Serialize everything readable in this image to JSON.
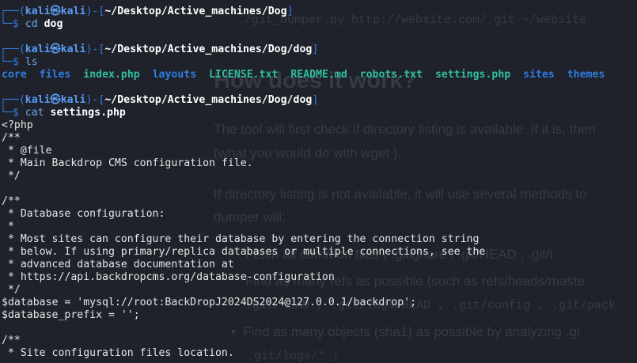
{
  "background_page": {
    "code_line": "./git_dumper.py http://website.com/.git ~/website",
    "heading": "How does it work?",
    "para1_line1": "The tool will first check if directory listing is available. If it is, then",
    "para1_line2": "(what you would do with  wget ).",
    "para2_line1": "If directory listing is not available, it will use several methods to",
    "para2_line2": "dumper will:",
    "bullet1": "Fetch all common files ( .gitignore ,  .git/HEAD ,  .git/i",
    "bullet2": "Find as many refs as possible (such as  refs/heads/maste",
    "bullet2_cont": ".git/HEAD ,  .git/logs/HEAD ,  .git/config ,  .git/pack",
    "bullet3": "Find as many objects (sha1) as possible by analyzing  .gi",
    "bullet3_cont": ".git/logs/* ;"
  },
  "prompt": {
    "user": "kali",
    "at": "㉿",
    "host": "kali"
  },
  "blocks": [
    {
      "path": "~/Desktop/Active_machines/Dog",
      "cmd": "cd",
      "arg": "dog"
    },
    {
      "path": "~/Desktop/Active_machines/Dog/dog",
      "cmd": "ls",
      "arg": ""
    },
    {
      "path": "~/Desktop/Active_machines/Dog/dog",
      "cmd": "cat",
      "arg": "settings.php"
    }
  ],
  "ls_output": [
    {
      "name": "core",
      "type": "dir"
    },
    {
      "name": "files",
      "type": "dir"
    },
    {
      "name": "index.php",
      "type": "file"
    },
    {
      "name": "layouts",
      "type": "dir"
    },
    {
      "name": "LICENSE.txt",
      "type": "file"
    },
    {
      "name": "README.md",
      "type": "file"
    },
    {
      "name": "robots.txt",
      "type": "file"
    },
    {
      "name": "settings.php",
      "type": "file"
    },
    {
      "name": "sites",
      "type": "dir"
    },
    {
      "name": "themes",
      "type": "dir"
    }
  ],
  "cat_output": [
    "<?php",
    "/**",
    " * @file",
    " * Main Backdrop CMS configuration file.",
    " */",
    "",
    "/**",
    " * Database configuration:",
    " *",
    " * Most sites can configure their database by entering the connection string",
    " * below. If using primary/replica databases or multiple connections, see the",
    " * advanced database documentation at",
    " * https://api.backdropcms.org/database-configuration",
    " */",
    "$database = 'mysql://root:BackDropJ2024DS2024@127.0.0.1/backdrop';",
    "$database_prefix = '';",
    "",
    "/**",
    " * Site configuration files location."
  ],
  "colors": {
    "background": "#1f222a",
    "prompt": "#2f7de1",
    "dir": "#2f7de1",
    "file": "#2fbfa0"
  }
}
